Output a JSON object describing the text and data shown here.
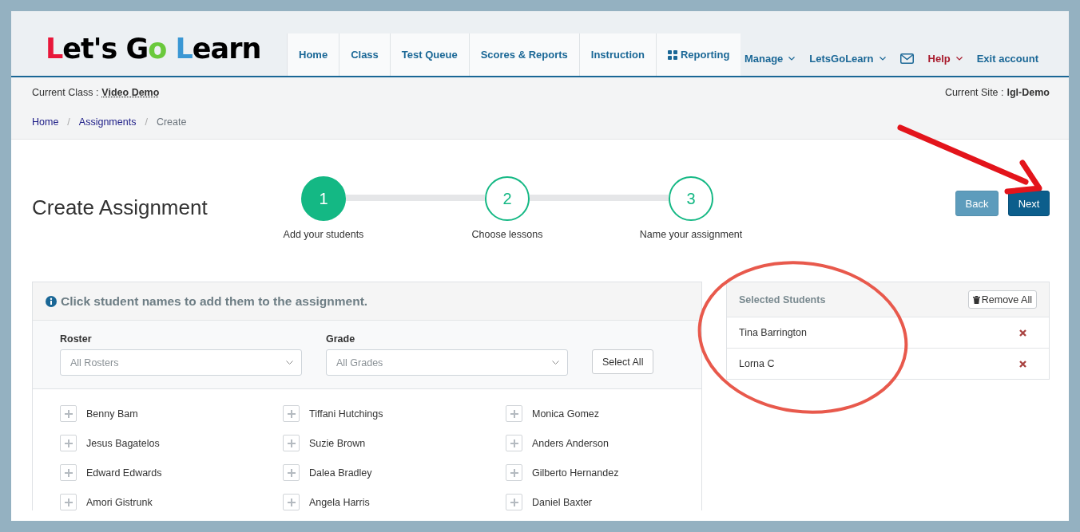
{
  "logo": {
    "text": "Let's Go Learn"
  },
  "nav_tabs": [
    {
      "label": "Home",
      "kind": "text"
    },
    {
      "label": "Class",
      "kind": "text"
    },
    {
      "label": "Test Queue",
      "kind": "text"
    },
    {
      "label": "Scores & Reports",
      "kind": "text"
    },
    {
      "label": "Instruction",
      "kind": "text"
    },
    {
      "label": "Reporting",
      "kind": "grid"
    }
  ],
  "nav_links": [
    {
      "label": "Manage",
      "kind": "dropdown",
      "color": "#1a6796"
    },
    {
      "label": "LetsGoLearn",
      "kind": "dropdown",
      "color": "#1a6796"
    },
    {
      "kind": "mail",
      "color": "#1a6796"
    },
    {
      "label": "Help",
      "kind": "dropdown",
      "color": "#a8192b"
    },
    {
      "label": "Exit account",
      "kind": "link",
      "color": "#1a6796"
    }
  ],
  "context": {
    "class_label": "Current Class :",
    "class_name": "Video Demo",
    "site_label": "Current Site :",
    "site_name": "lgl-Demo"
  },
  "breadcrumb": {
    "separator": "/",
    "items": [
      {
        "label": "Home",
        "current": false
      },
      {
        "label": "Assignments",
        "current": false
      },
      {
        "label": "Create",
        "current": true
      }
    ]
  },
  "page_title": "Create Assignment",
  "steps": [
    {
      "number": "1",
      "label": "Add your students",
      "selected": true
    },
    {
      "number": "2",
      "label": "Choose lessons",
      "selected": false
    },
    {
      "number": "3",
      "label": "Name your assignment",
      "selected": false
    }
  ],
  "buttons": [
    {
      "label": "Back",
      "kind": "secondary"
    },
    {
      "label": "Next",
      "kind": "primary"
    }
  ],
  "student_panel": {
    "instruction": "Click student names to add them to the assignment.",
    "filters": [
      {
        "label": "Roster",
        "placeholder": "All Rosters"
      },
      {
        "label": "Grade",
        "placeholder": "All Grades"
      }
    ],
    "select_all": "Select All",
    "students": [
      "Benny Bam",
      "Tiffani Hutchings",
      "Monica Gomez",
      "Jesus Bagatelos",
      "Suzie Brown",
      "Anders Anderson",
      "Edward Edwards",
      "Dalea Bradley",
      "Gilberto Hernandez",
      "Amori Gistrunk",
      "Angela Harris",
      "Daniel Baxter"
    ]
  },
  "selected_panel": {
    "title": "Selected Students",
    "remove_all": "Remove All",
    "students": [
      "Tina Barrington",
      "Lorna C"
    ]
  },
  "annotations": [
    {
      "kind": "arrow",
      "color": "#e3141b"
    },
    {
      "kind": "ellipse",
      "color": "#e8594c"
    }
  ]
}
